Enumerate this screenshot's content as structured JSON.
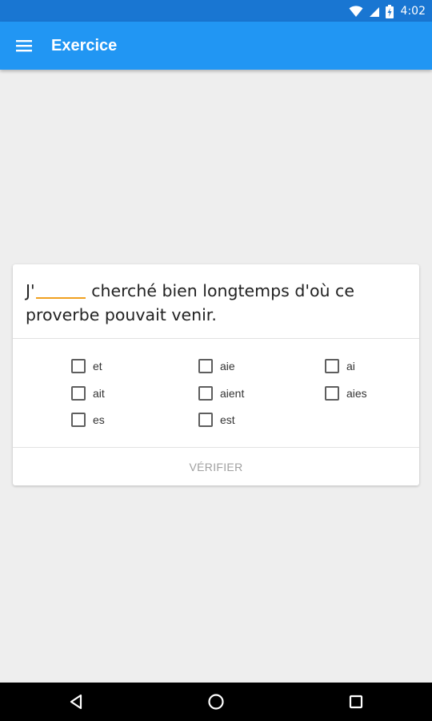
{
  "status_bar": {
    "time": "4:02",
    "icons": [
      "wifi-icon",
      "cell-signal-icon",
      "battery-charging-icon"
    ]
  },
  "app_bar": {
    "title": "Exercice",
    "menu_icon": "hamburger-menu-icon",
    "color": "#2196f3",
    "status_color": "#1976d2"
  },
  "exercise": {
    "question_prefix": "J'",
    "question_suffix": " cherché bien longtemps d'où ce proverbe pouvait venir.",
    "blank_color": "#f0a020",
    "options": [
      {
        "label": "et",
        "checked": false
      },
      {
        "label": "aie",
        "checked": false
      },
      {
        "label": "ai",
        "checked": false
      },
      {
        "label": "ait",
        "checked": false
      },
      {
        "label": "aient",
        "checked": false
      },
      {
        "label": "aies",
        "checked": false
      },
      {
        "label": "es",
        "checked": false
      },
      {
        "label": "est",
        "checked": false
      }
    ],
    "verify_label": "VÉRIFIER"
  },
  "nav_bar": {
    "icons": [
      "back-icon",
      "home-icon",
      "recents-icon"
    ]
  }
}
